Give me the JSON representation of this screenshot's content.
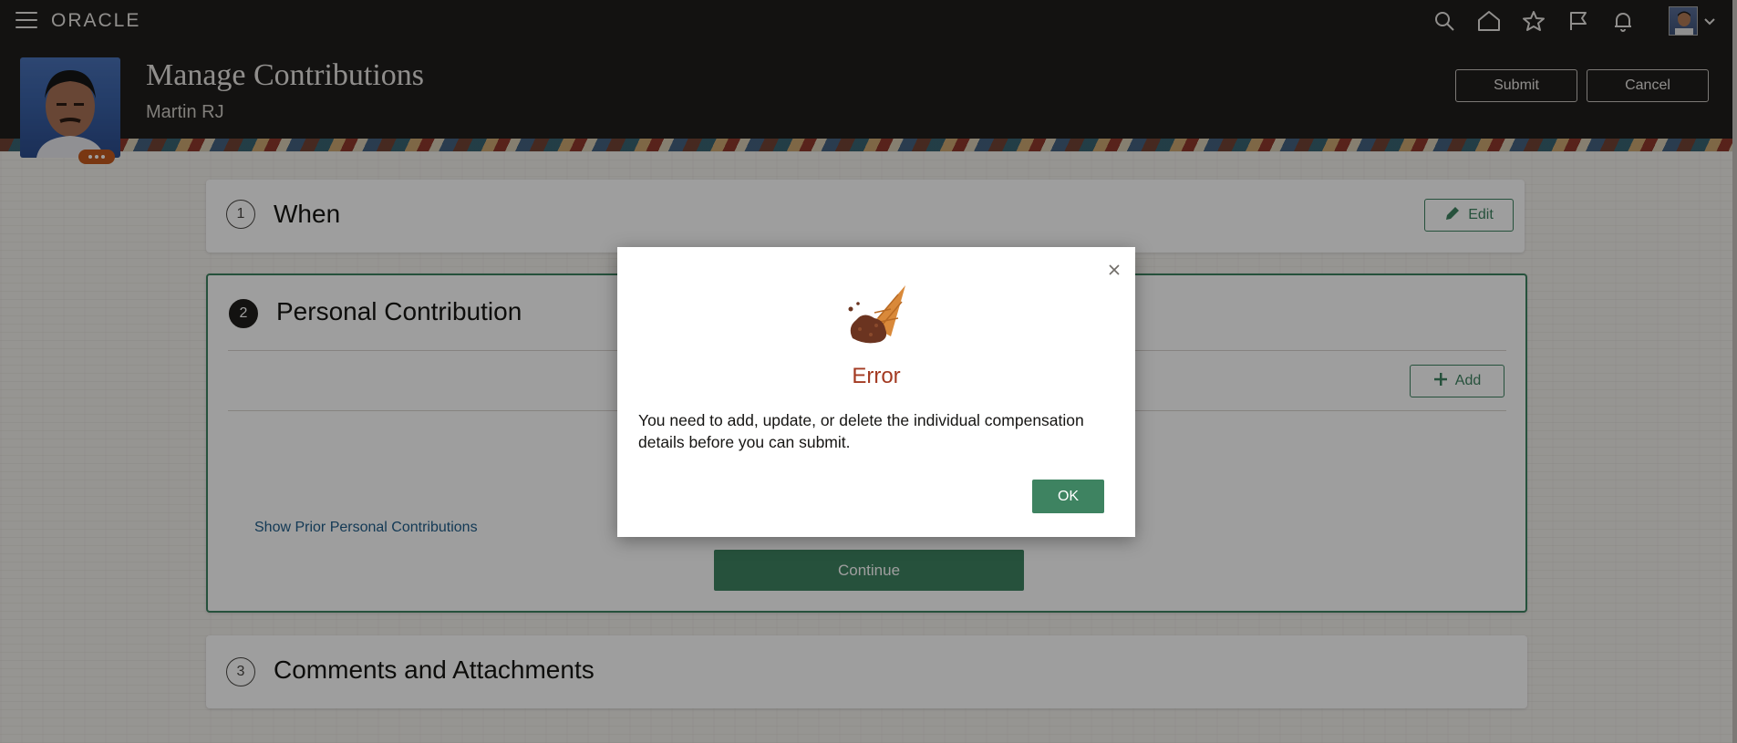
{
  "app": {
    "brand": "ORACLE"
  },
  "header": {
    "title": "Manage Contributions",
    "subtitle": "Martin RJ",
    "submit_label": "Submit",
    "cancel_label": "Cancel"
  },
  "topbar": {
    "icons": [
      "search-icon",
      "home-icon",
      "favorites-star-icon",
      "flag-icon",
      "notifications-bell-icon"
    ]
  },
  "sections": {
    "when": {
      "step": "1",
      "title": "When",
      "edit_label": "Edit"
    },
    "personal": {
      "step": "2",
      "title": "Personal Contribution",
      "add_label": "Add",
      "prior_link": "Show Prior Personal Contributions",
      "continue_label": "Continue"
    },
    "comments": {
      "step": "3",
      "title": "Comments and Attachments"
    }
  },
  "dialog": {
    "title": "Error",
    "message": "You need to add, update, or delete the individual compensation details before you can submit.",
    "ok_label": "OK"
  },
  "colors": {
    "accent_green": "#3e8361",
    "error_red": "#a33a22",
    "header_dark": "#201e1c",
    "link_blue": "#1f5d8a"
  }
}
